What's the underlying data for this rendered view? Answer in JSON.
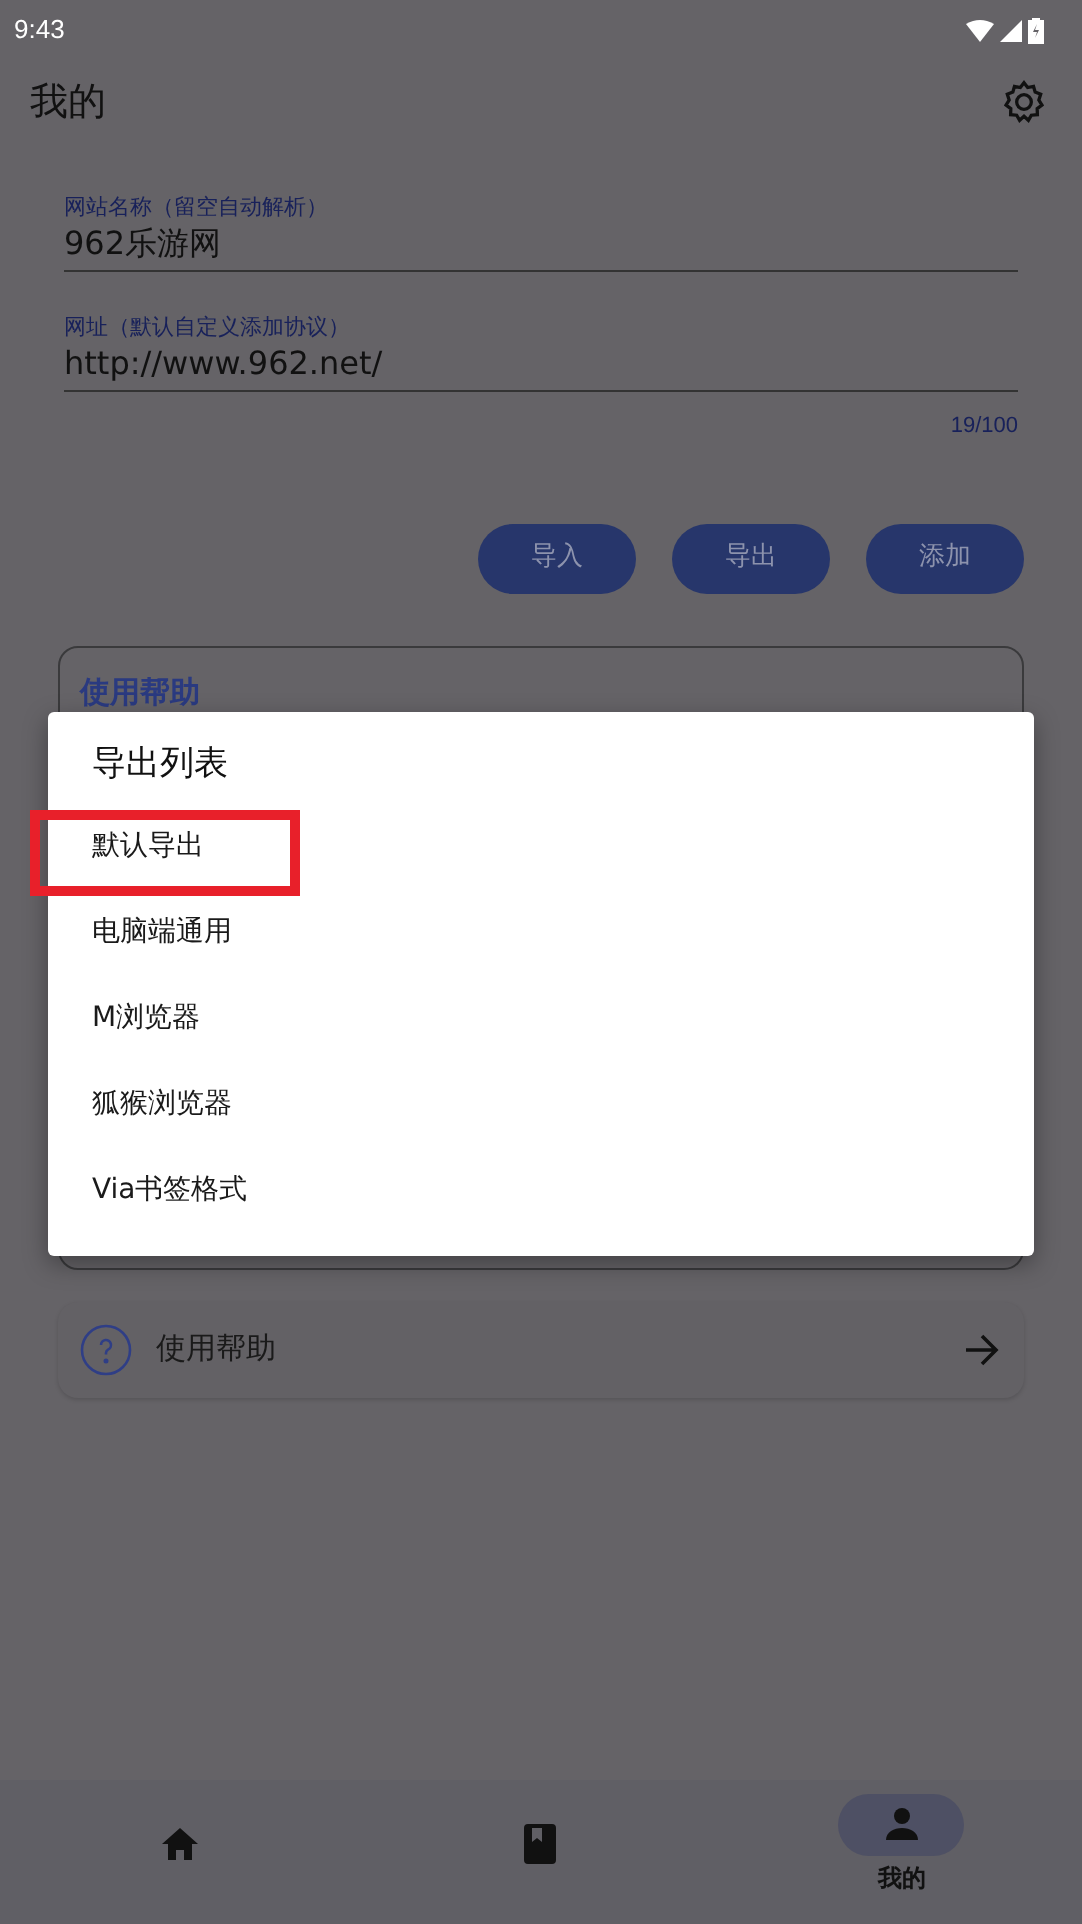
{
  "status_bar": {
    "time": "9:43"
  },
  "header": {
    "title": "我的"
  },
  "fields": [
    {
      "label": "网站名称（留空自动解析）",
      "value": "962乐游网"
    },
    {
      "label": "网址（默认自定义添加协议）",
      "value": "http://www.962.net/",
      "counter": "19/100"
    }
  ],
  "buttons": [
    "导入",
    "导出",
    "添加"
  ],
  "help_card": {
    "title": "使用帮助"
  },
  "help_row": {
    "label": "使用帮助"
  },
  "dialog": {
    "title": "导出列表",
    "items": [
      {
        "label": "默认导出",
        "highlighted": true
      },
      {
        "label": "电脑端通用",
        "highlighted": false
      },
      {
        "label": "M浏览器",
        "highlighted": false
      },
      {
        "label": "狐猴浏览器",
        "highlighted": false
      },
      {
        "label": "Via书签格式",
        "highlighted": false
      }
    ]
  },
  "bottom_nav": [
    {
      "kind": "home",
      "selected": false
    },
    {
      "kind": "book",
      "selected": false
    },
    {
      "kind": "person",
      "label": "我的",
      "selected": true
    }
  ]
}
